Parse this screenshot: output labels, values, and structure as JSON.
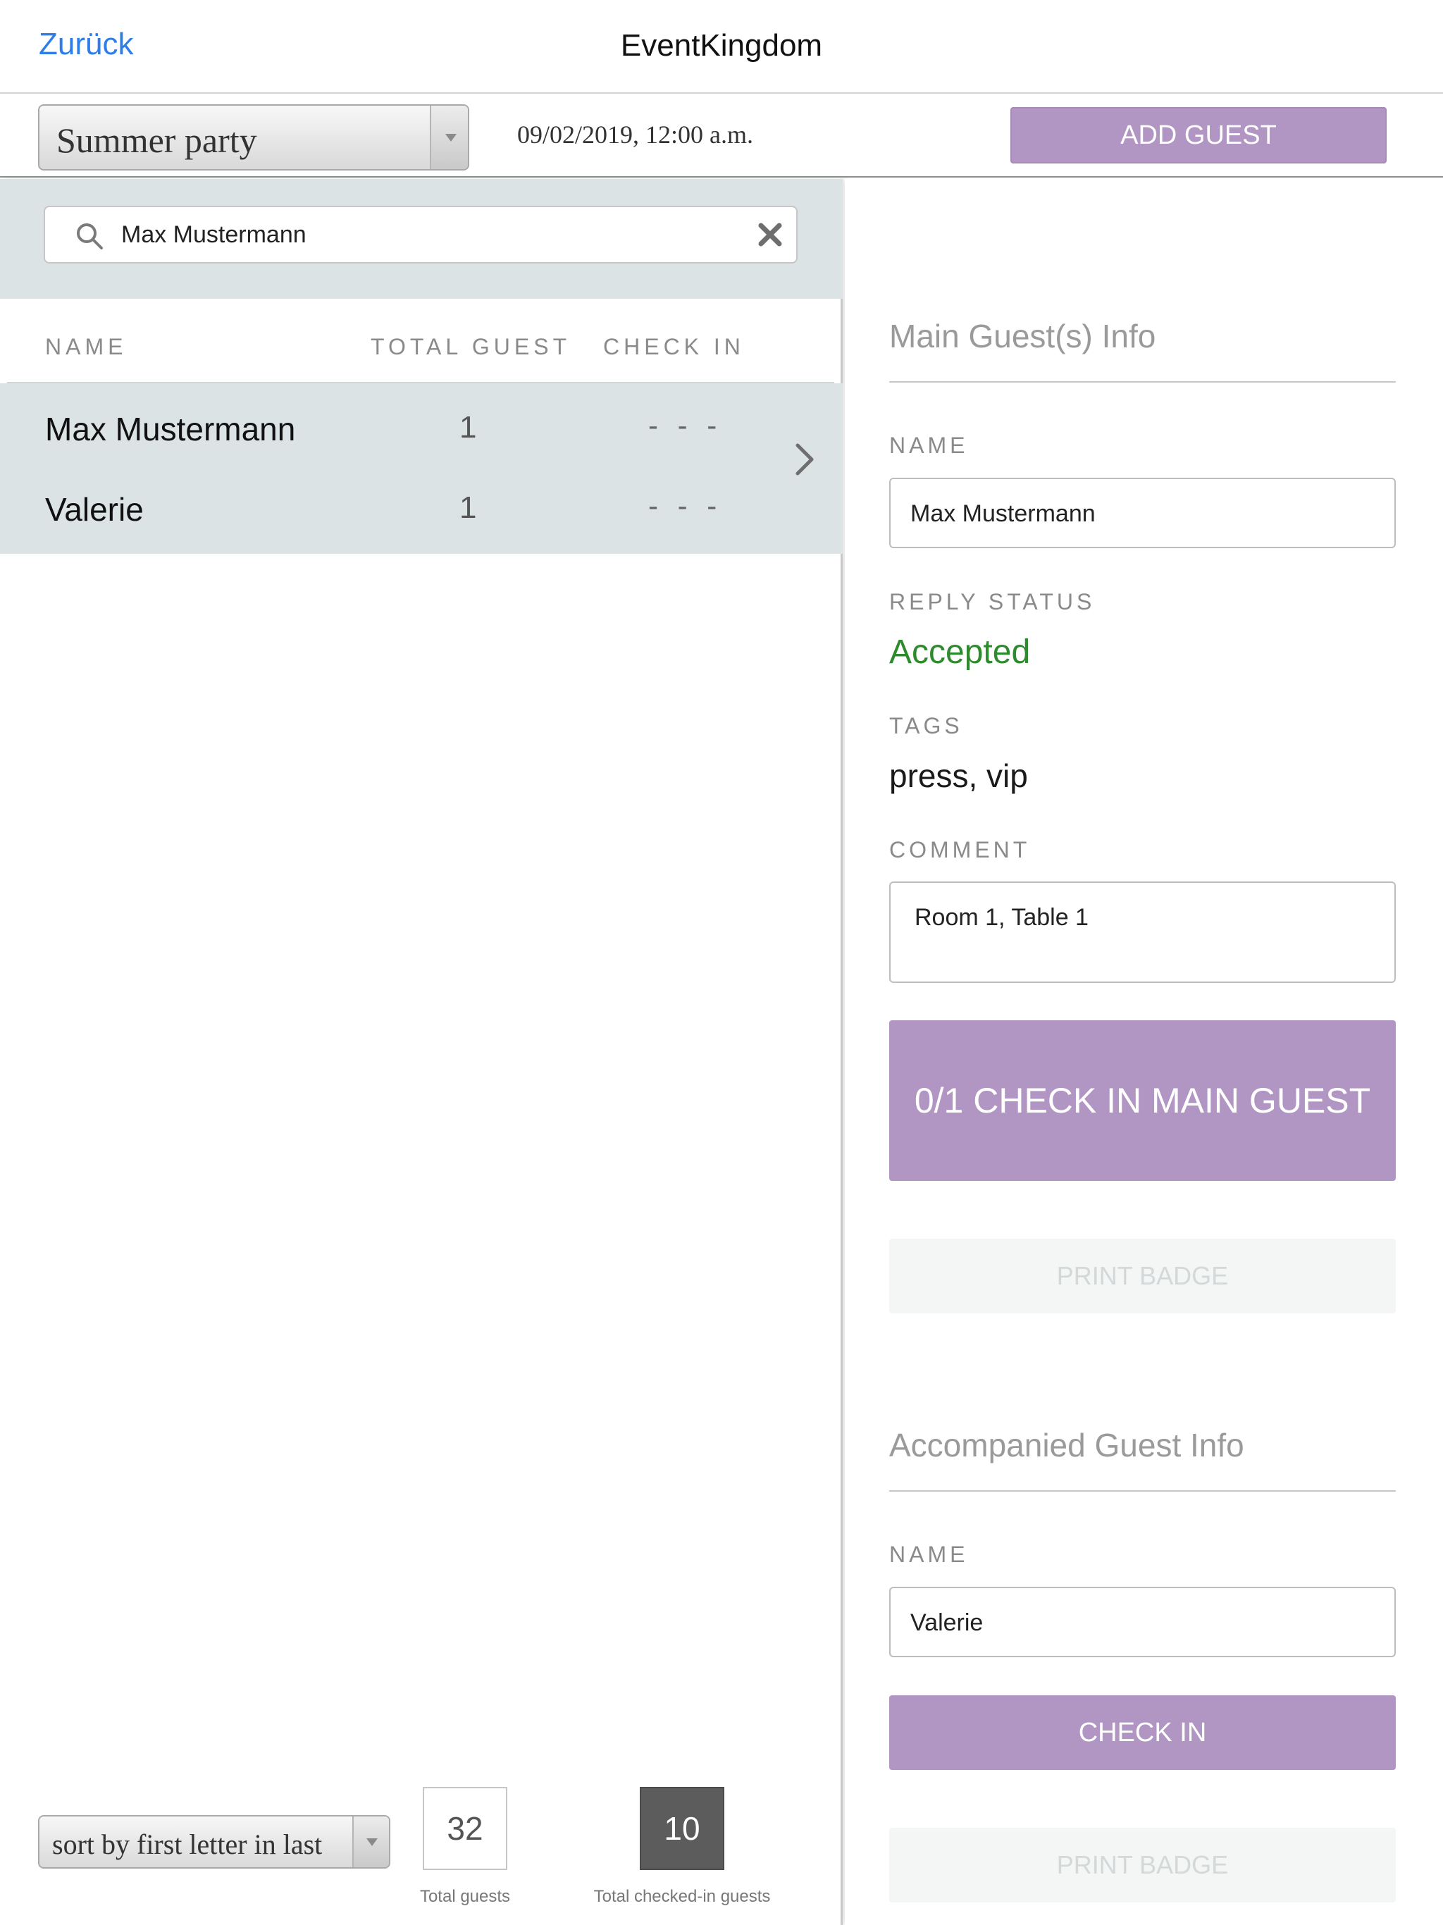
{
  "nav": {
    "back_label": "Zurück",
    "title": "EventKingdom"
  },
  "toolbar": {
    "event_selected": "Summer party",
    "event_datetime": "09/02/2019, 12:00 a.m.",
    "add_guest_label": "ADD GUEST"
  },
  "search": {
    "value": "Max Mustermann",
    "icon": "search-icon",
    "clear_icon": "close-icon"
  },
  "guest_table": {
    "columns": [
      "NAME",
      "TOTAL GUEST",
      "CHECK IN"
    ],
    "rows": [
      {
        "name": "Max Mustermann",
        "total": "1",
        "check_in": "- - -"
      },
      {
        "name": "Valerie",
        "total": "1",
        "check_in": "- - -"
      }
    ]
  },
  "footer": {
    "sort_selected": "sort by first letter in last",
    "total_guests": "32",
    "total_guests_label": "Total guests",
    "checked_in": "10",
    "checked_in_label": "Total checked-in guests"
  },
  "main_guest": {
    "section_title": "Main Guest(s) Info",
    "name_label": "NAME",
    "name_value": "Max Mustermann",
    "reply_status_label": "REPLY STATUS",
    "reply_status": "Accepted",
    "tags_label": "TAGS",
    "tags": "press, vip",
    "comment_label": "COMMENT",
    "comment": "Room 1, Table 1",
    "check_in_button": "0/1 CHECK IN MAIN GUEST",
    "print_badge_button": "PRINT BADGE"
  },
  "accompanied_guest": {
    "section_title": "Accompanied Guest Info",
    "name_label": "NAME",
    "name_value": "Valerie",
    "check_in_button": "CHECK IN",
    "print_badge_button": "PRINT BADGE"
  },
  "colors": {
    "accent_purple": "#b195c3",
    "link_blue": "#2f7ee8",
    "accepted_green": "#2d8a2d",
    "list_background": "#dce3e5"
  }
}
